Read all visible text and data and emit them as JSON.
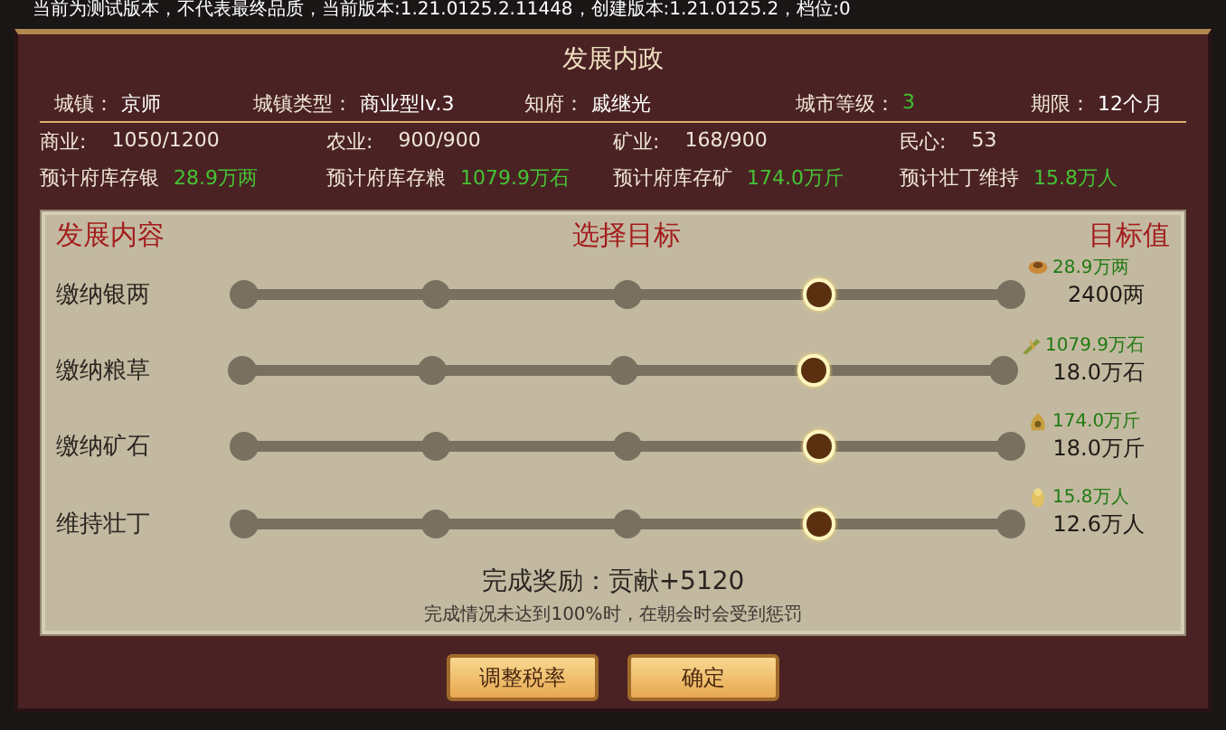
{
  "notice": "当前为测试版本，不代表最终品质，当前版本:1.21.0125.2.11448，创建版本:1.21.0125.2，档位:0",
  "window": {
    "title": "发展内政"
  },
  "city_info": [
    {
      "label": "城镇：",
      "value": "京师",
      "color": "#ffffff"
    },
    {
      "label": "城镇类型：",
      "value": "商业型lv.3",
      "color": "#ffffff"
    },
    {
      "label": "知府：",
      "value": "戚继光",
      "color": "#ffffff"
    },
    {
      "label": "城市等级：",
      "value": "3",
      "color": "#3fc22f"
    },
    {
      "label": "期限：",
      "value": "12个月",
      "color": "#ffffff"
    }
  ],
  "industry": [
    {
      "label": "商业:",
      "value": "1050/1200"
    },
    {
      "label": "农业:",
      "value": "900/900"
    },
    {
      "label": "矿业:",
      "value": "168/900"
    },
    {
      "label": "民心:",
      "value": "53"
    }
  ],
  "forecast": [
    {
      "label": "预计府库存银",
      "value": "28.9万两"
    },
    {
      "label": "预计府库存粮",
      "value": "1079.9万石"
    },
    {
      "label": "预计府库存矿",
      "value": "174.0万斤"
    },
    {
      "label": "预计壮丁维持",
      "value": "15.8万人"
    }
  ],
  "panel": {
    "headers": [
      "发展内容",
      "选择目标",
      "目标值"
    ],
    "rows": [
      {
        "label": "缴纳银两",
        "kind": "silver",
        "level": 0.75,
        "stock": "28.9万两",
        "target": "2400两"
      },
      {
        "label": "缴纳粮草",
        "kind": "grain",
        "level": 0.75,
        "stock": "1079.9万石",
        "target": "18.0万石"
      },
      {
        "label": "缴纳矿石",
        "kind": "ore",
        "level": 0.75,
        "stock": "174.0万斤",
        "target": "18.0万斤"
      },
      {
        "label": "维持壮丁",
        "kind": "people",
        "level": 0.75,
        "stock": "15.8万人",
        "target": "12.6万人"
      }
    ],
    "reward": "完成奖励：贡献+5120",
    "note": "完成情况未达到100%时，在朝会时会受到惩罚"
  },
  "buttons": [
    "调整税率",
    "确定"
  ]
}
